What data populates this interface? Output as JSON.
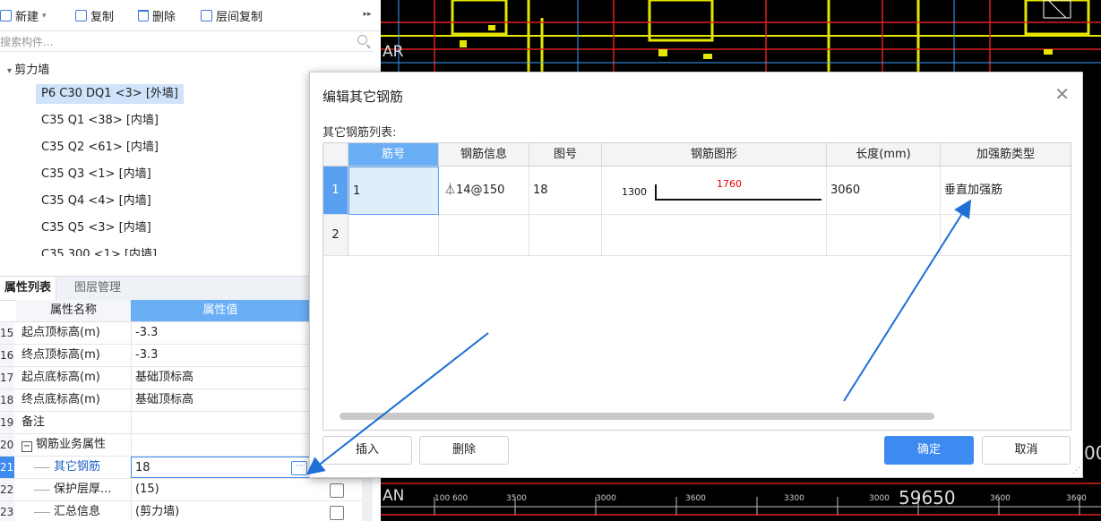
{
  "toolbar": {
    "new_label": "新建",
    "copy_label": "复制",
    "delete_label": "删除",
    "floor_copy_label": "层间复制"
  },
  "search": {
    "placeholder": "搜索构件..."
  },
  "tree": {
    "root": "剪力墙",
    "items": [
      "P6  C30  DQ1 <3> [外墙]",
      "C35  Q1 <38> [内墙]",
      "C35  Q2 <61> [内墙]",
      "C35  Q3 <1> [内墙]",
      "C35  Q4 <4> [内墙]",
      "C35  Q5 <3> [内墙]",
      "C35  300 <1> [内墙]"
    ]
  },
  "tabs": {
    "properties": "属性列表",
    "layers": "图层管理"
  },
  "props": {
    "header_name": "属性名称",
    "header_value": "属性值",
    "rows": [
      {
        "num": "15",
        "name": "起点顶标高(m)",
        "value": "-3.3"
      },
      {
        "num": "16",
        "name": "终点顶标高(m)",
        "value": "-3.3"
      },
      {
        "num": "17",
        "name": "起点底标高(m)",
        "value": "基础顶标高"
      },
      {
        "num": "18",
        "name": "终点底标高(m)",
        "value": "基础顶标高"
      },
      {
        "num": "19",
        "name": "备注",
        "value": ""
      },
      {
        "num": "20",
        "name": "钢筋业务属性",
        "value": ""
      },
      {
        "num": "21",
        "name": "其它钢筋",
        "value": "18"
      },
      {
        "num": "22",
        "name": "保护层厚...",
        "value": "(15)"
      },
      {
        "num": "23",
        "name": "汇总信息",
        "value": "(剪力墙)"
      }
    ]
  },
  "cad": {
    "labels": [
      "AR",
      "AN",
      "59650",
      "00"
    ],
    "dims": [
      "100",
      "600",
      "3500",
      "3000",
      "3600",
      "3300",
      "3000",
      "3600",
      "3600"
    ]
  },
  "dialog": {
    "title": "编辑其它钢筋",
    "subtitle": "其它钢筋列表:",
    "columns": [
      "筋号",
      "钢筋信息",
      "图号",
      "钢筋图形",
      "长度(mm)",
      "加强筋类型"
    ],
    "rows": [
      {
        "rn": "1",
        "bar_no": "1",
        "info": "⏃14@150",
        "fig": "18",
        "shape_left": "1300",
        "shape_top": "1760",
        "length": "3060",
        "type": "垂直加强筋"
      },
      {
        "rn": "2",
        "bar_no": "",
        "info": "",
        "fig": "",
        "shape_left": "",
        "shape_top": "",
        "length": "",
        "type": ""
      }
    ],
    "buttons": {
      "insert": "插入",
      "delete": "删除",
      "ok": "确定",
      "cancel": "取消"
    }
  },
  "colors": {
    "accent": "#3d8af0",
    "arrow": "#1f6fd6",
    "highlight_header": "#6aaef5"
  }
}
